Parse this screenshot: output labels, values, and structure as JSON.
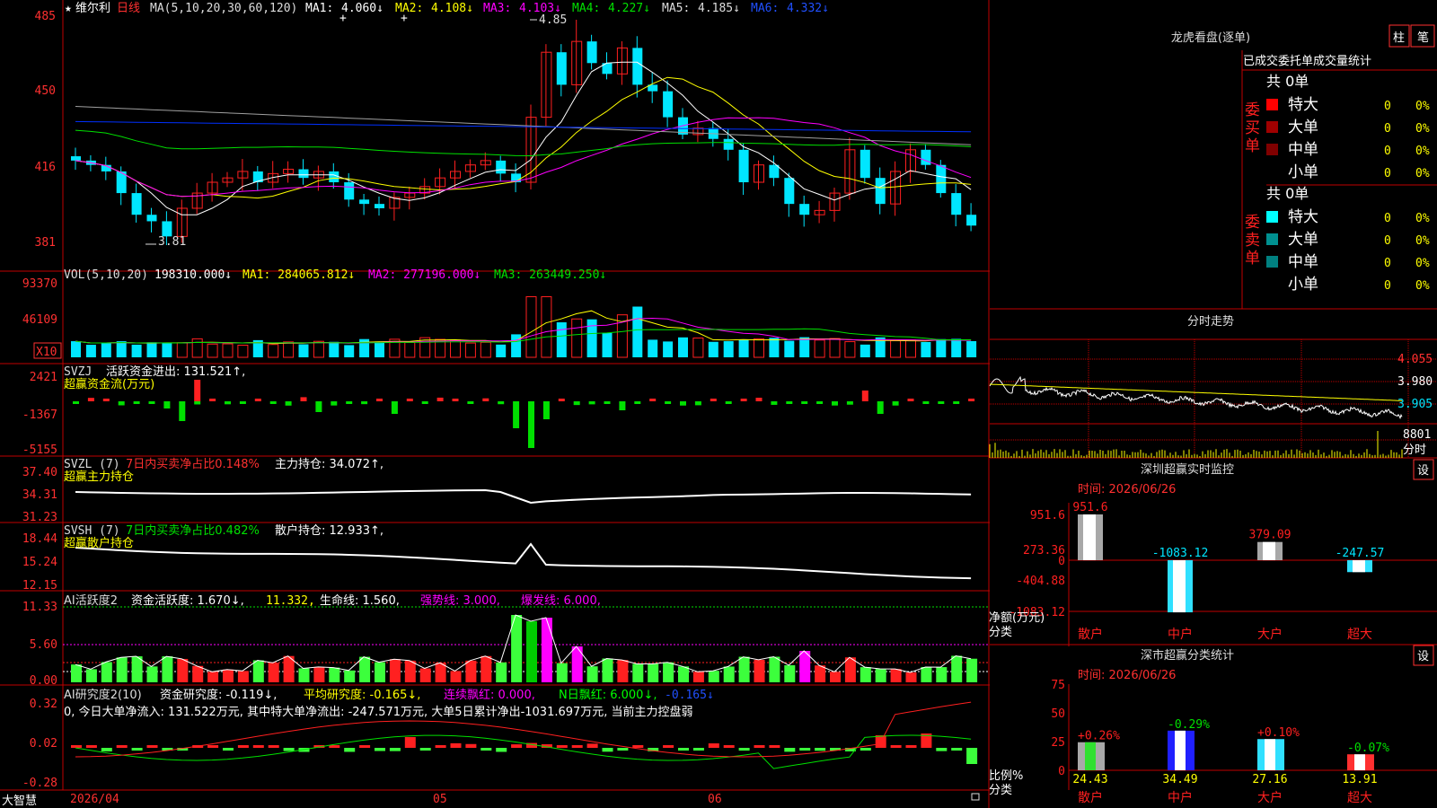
{
  "colors": {
    "up": "#ff2020",
    "down": "#00e6ff",
    "grid": "#c00000",
    "axis": "#ff3030",
    "white": "#ffffff",
    "yellow": "#ffff00",
    "magenta": "#ff00ff",
    "green": "#00e000",
    "blue": "#0030ff",
    "gray": "#a0a0a0",
    "limeGreen": "#3cff3c"
  },
  "header": {
    "star": "★",
    "stock_name": "维尔利",
    "period": "日线",
    "ma_params": "MA(5,10,20,30,60,120)",
    "ma": [
      {
        "name": "MA1:",
        "value": "4.060↓"
      },
      {
        "name": "MA2:",
        "value": "4.108↓"
      },
      {
        "name": "MA3:",
        "value": "4.103↓"
      },
      {
        "name": "MA4:",
        "value": "4.227↓"
      },
      {
        "name": "MA5:",
        "value": "4.185↓"
      },
      {
        "name": "MA6:",
        "value": "4.332↓"
      }
    ],
    "high_mark": "4.85",
    "low_mark": "3.81"
  },
  "price_axis": [
    "485",
    "450",
    "416",
    "381"
  ],
  "vol": {
    "title": "VOL(5,10,20)",
    "value": "198310.000↓",
    "ma1": "MA1: 284065.812↓",
    "ma2": "MA2: 277196.000↓",
    "ma3": "MA3: 263449.250↓",
    "axis": [
      "93370",
      "46109"
    ],
    "unit": "X10"
  },
  "svzj": {
    "title": "SVZJ",
    "label": "活跃资金进出: 131.521↑,",
    "sub": "超赢资金流(万元)",
    "axis": [
      "2421",
      "-1367",
      "-5155"
    ]
  },
  "svzl": {
    "title": "SVZL (7)",
    "label1": "7日内买卖净占比0.148%",
    "label2": "主力持仓: 34.072↑,",
    "sub": "超赢主力持仓",
    "axis": [
      "37.40",
      "34.31",
      "31.23"
    ]
  },
  "svsh": {
    "title": "SVSH (7)",
    "label1": "7日内买卖净占比0.482%",
    "label2": "散户持仓: 12.933↑,",
    "sub": "超赢散户持仓",
    "axis": [
      "18.44",
      "15.24",
      "12.15"
    ]
  },
  "ai2": {
    "title": "AI活跃度2",
    "label1": "资金活跃度: 1.670↓,",
    "label2": "11.332,",
    "label3": "生命线: 1.560,",
    "label4": "强势线: 3.000,",
    "label5": "爆发线: 6.000,",
    "axis": [
      "11.33",
      "5.60",
      "0.00"
    ]
  },
  "ai_res": {
    "title": "AI研究度2(10)",
    "label1": "资金研究度: -0.119↓,",
    "label2": "平均研究度: -0.165↓,",
    "label3": "连续飘红: 0.000,",
    "label4": "N日飘红: 6.000↓,",
    "label5": "-0.165↓",
    "desc": "0, 今日大单净流入: 131.522万元, 其中特大单净流出: -247.571万元, 大单5日累计净出-1031.697万元, 当前主力控盘弱",
    "axis": [
      "0.32",
      "0.02",
      "-0.28"
    ]
  },
  "bottom": {
    "brand": "大智慧",
    "date": "2026/04",
    "m05": "05",
    "m06": "06"
  },
  "right": {
    "lhb_title": "龙虎看盘(逐单)",
    "btn_zhu": "柱",
    "btn_bi": "笔",
    "stat_title": "已成交委托单成交量统计",
    "buy_side": "委买单",
    "sell_side": "委卖单",
    "buy_total": "共 0单",
    "sell_total": "共 0单",
    "rows_buy": [
      {
        "name": "特大",
        "v": "0",
        "p": "0%",
        "c": "#ff0000"
      },
      {
        "name": "大单",
        "v": "0",
        "p": "0%",
        "c": "#a00000"
      },
      {
        "name": "中单",
        "v": "0",
        "p": "0%",
        "c": "#800000"
      },
      {
        "name": "小单",
        "v": "0",
        "p": "0%",
        "c": ""
      }
    ],
    "rows_sell": [
      {
        "name": "特大",
        "v": "0",
        "p": "0%",
        "c": "#00ffff"
      },
      {
        "name": "大单",
        "v": "0",
        "p": "0%",
        "c": "#009090"
      },
      {
        "name": "中单",
        "v": "0",
        "p": "0%",
        "c": "#008080"
      },
      {
        "name": "小单",
        "v": "0",
        "p": "0%",
        "c": ""
      }
    ],
    "fenshi_title": "分时走势",
    "fenshi_axis": [
      "4.055",
      "3.980",
      "3.905"
    ],
    "fenshi_vol": "8801",
    "fenshi_label": "分时",
    "sz_title": "深圳超赢实时监控",
    "sz_btn": "设",
    "sz_time": "时间: 2026/06/26",
    "sz_axis": [
      "951.6",
      "273.36",
      "0",
      "-404.88",
      "-1083.12"
    ],
    "sz_unit": "净额(万元)",
    "sz_cat": "分类",
    "sz_bars": [
      {
        "name": "散户",
        "value": 951.6,
        "label": "951.6"
      },
      {
        "name": "中户",
        "value": -1083.12,
        "label": "-1083.12"
      },
      {
        "name": "大户",
        "value": 379.09,
        "label": "379.09"
      },
      {
        "name": "超大",
        "value": -247.57,
        "label": "-247.57"
      }
    ],
    "cls_title": "深市超赢分类统计",
    "cls_btn": "设",
    "cls_time": "时间: 2026/06/26",
    "cls_axis": [
      "75",
      "50",
      "25",
      "0"
    ],
    "cls_unit": "比例%",
    "cls_cat": "分类",
    "cls_bars": [
      {
        "name": "散户",
        "value": 24.43,
        "label": "24.43",
        "chg": "+0.26%"
      },
      {
        "name": "中户",
        "value": 34.49,
        "label": "34.49",
        "chg": "-0.29%"
      },
      {
        "name": "大户",
        "value": 27.16,
        "label": "27.16",
        "chg": "+0.10%"
      },
      {
        "name": "超大",
        "value": 13.91,
        "label": "13.91",
        "chg": "-0.07%"
      }
    ]
  }
}
